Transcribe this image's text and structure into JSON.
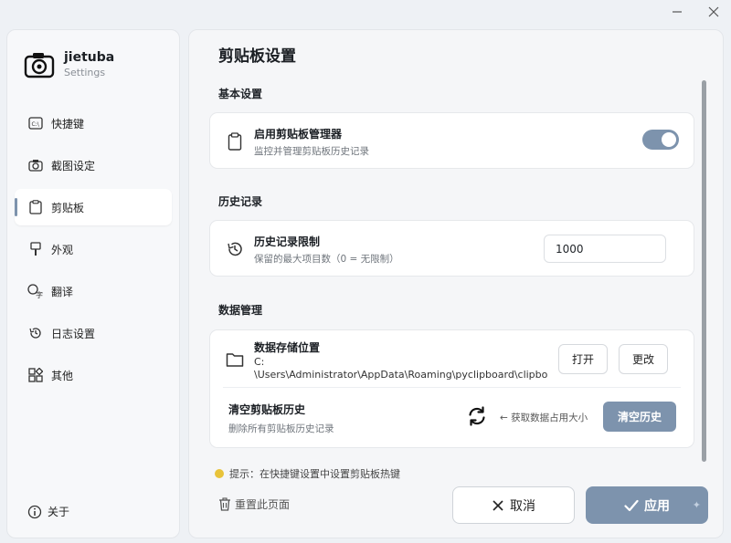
{
  "app": {
    "name": "jietuba",
    "subtitle": "Settings"
  },
  "window": {
    "minimize_glyph": "—",
    "close_glyph": "✕"
  },
  "sidebar": {
    "items": [
      {
        "label": "快捷键",
        "icon": "keyboard-icon"
      },
      {
        "label": "截图设定",
        "icon": "camera-icon"
      },
      {
        "label": "剪贴板",
        "icon": "clipboard-icon",
        "active": true
      },
      {
        "label": "外观",
        "icon": "brush-icon"
      },
      {
        "label": "翻译",
        "icon": "translate-icon"
      },
      {
        "label": "日志设置",
        "icon": "history-icon"
      },
      {
        "label": "其他",
        "icon": "grid-icon"
      }
    ],
    "about_label": "关于"
  },
  "main": {
    "title": "剪贴板设置",
    "sections": {
      "basic": "基本设置",
      "history": "历史记录",
      "data": "数据管理"
    },
    "enable": {
      "title": "启用剪贴板管理器",
      "desc": "监控并管理剪贴板历史记录",
      "enabled": true
    },
    "history_limit": {
      "title": "历史记录限制",
      "desc": "保留的最大项目数（0 = 无限制）",
      "value": "1000"
    },
    "storage": {
      "title": "数据存储位置",
      "path_line1": "C:",
      "path_line2": "\\Users\\Administrator\\AppData\\Roaming\\pyclipboard\\clipboa",
      "open_label": "打开",
      "change_label": "更改"
    },
    "clear": {
      "title": "清空剪贴板历史",
      "desc": "删除所有剪贴板历史记录",
      "size_hint": "← 获取数据占用大小",
      "button_label": "清空历史"
    },
    "tip": "提示：在快捷键设置中设置剪贴板热键"
  },
  "footer": {
    "reset_label": "重置此页面",
    "cancel_label": "取消",
    "apply_label": "应用"
  },
  "colors": {
    "accent": "#7d93ad",
    "background": "#eef1f5"
  }
}
